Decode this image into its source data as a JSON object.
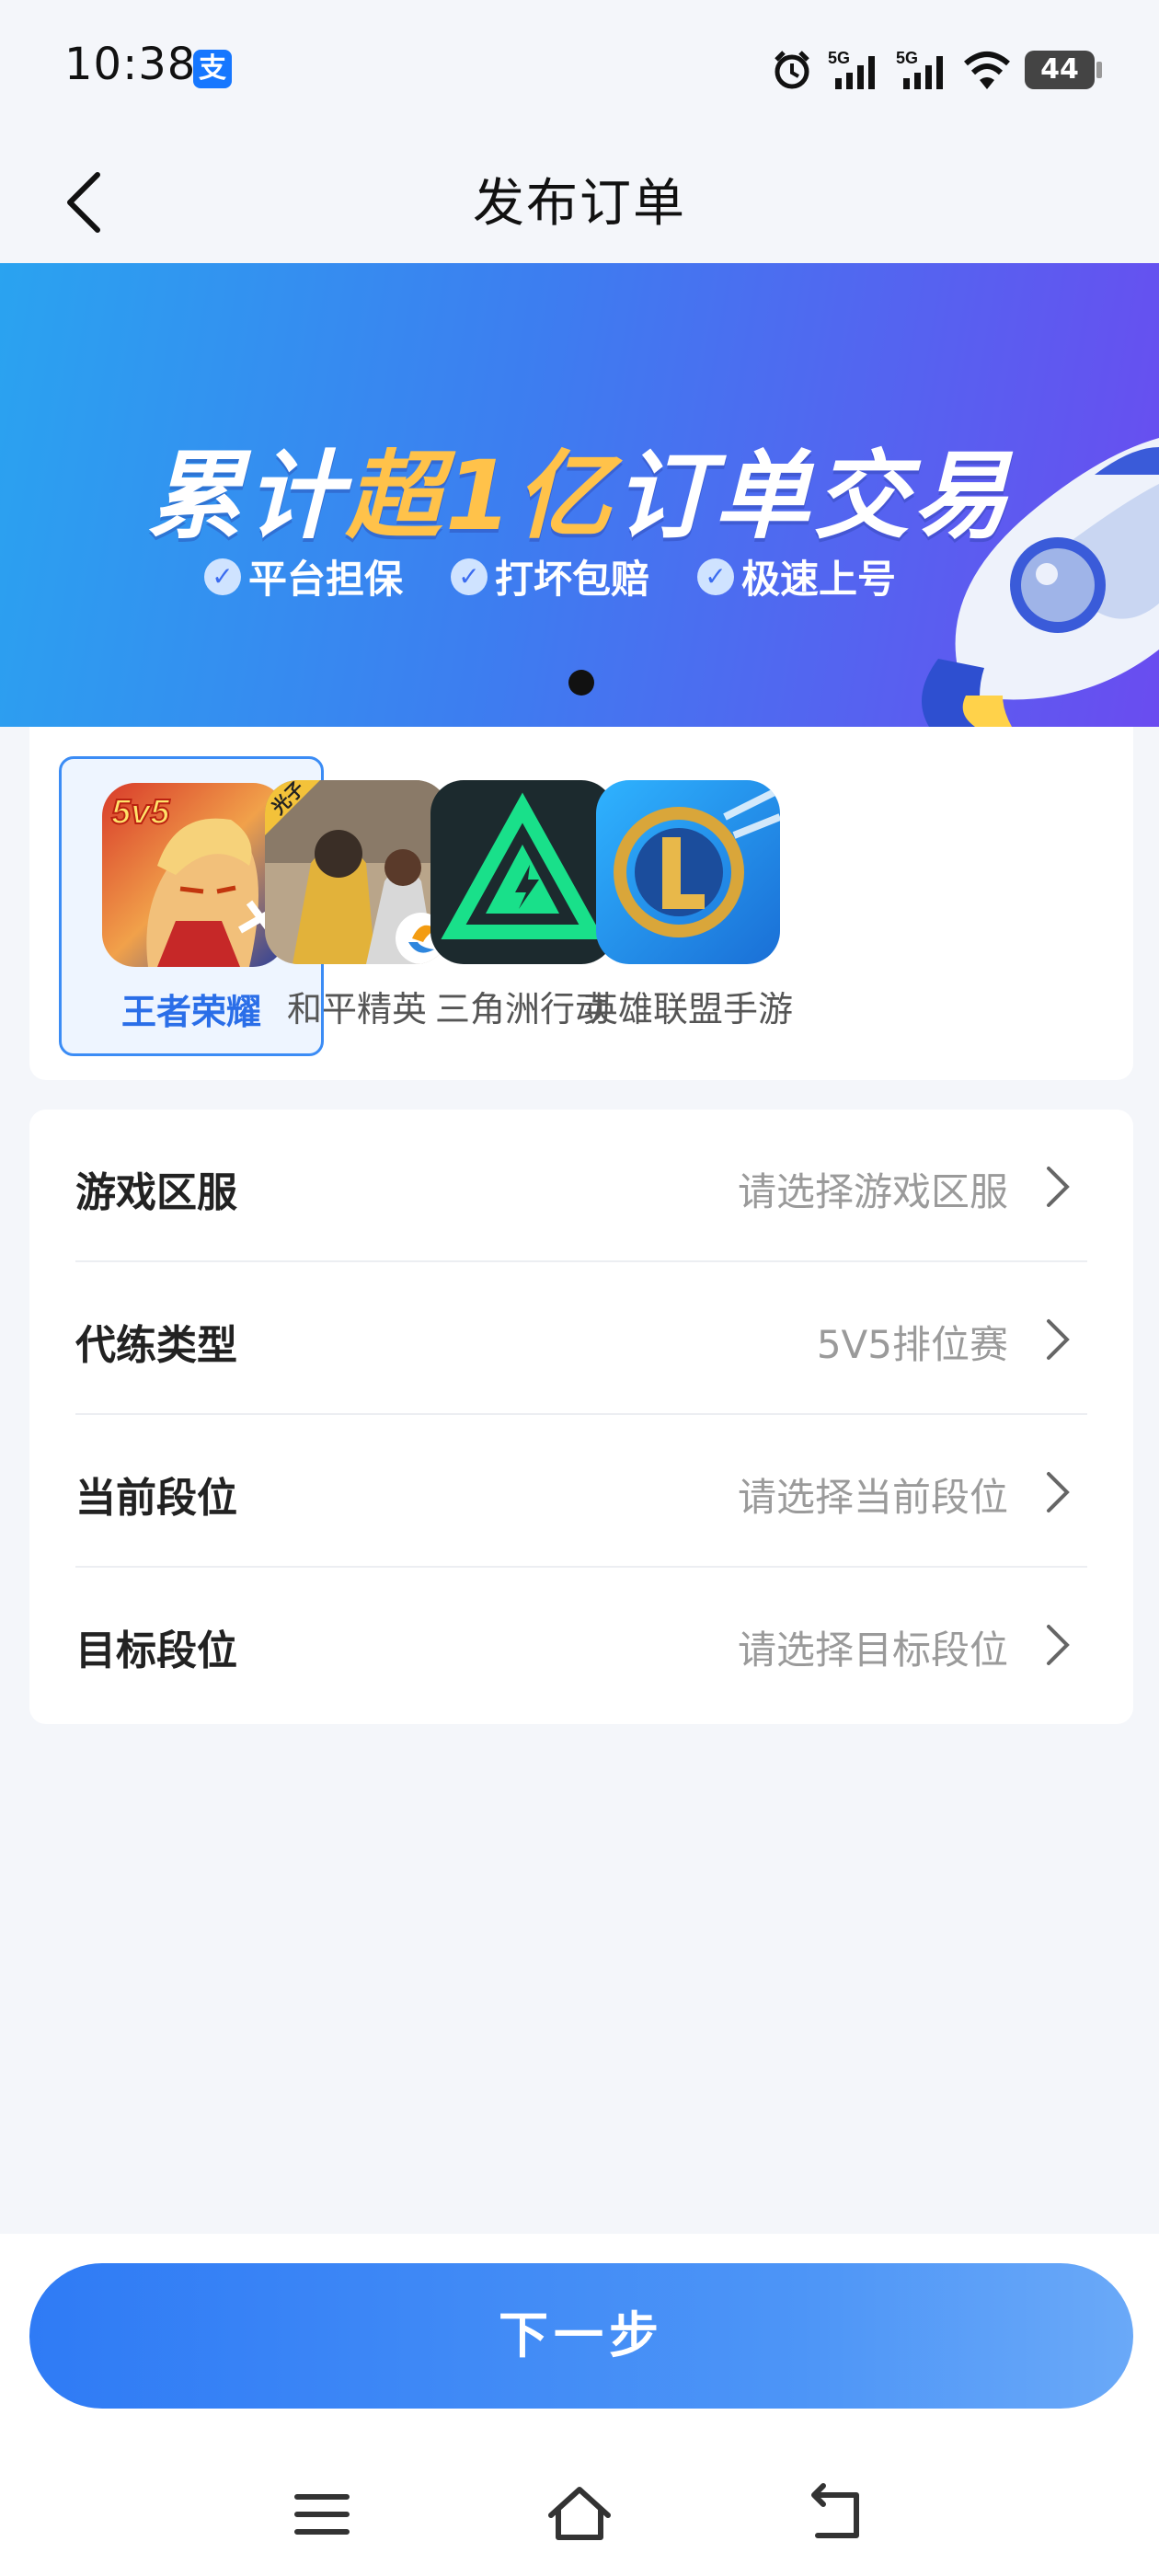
{
  "status_bar": {
    "time": "10:38",
    "app_badge": "支",
    "signal_1_label": "5G",
    "signal_2_label": "5G",
    "battery": "44"
  },
  "header": {
    "title": "发布订单"
  },
  "banner": {
    "headline_part1": "累计",
    "headline_highlight": "超1亿",
    "headline_part2": "订单交易",
    "features": [
      "平台担保",
      "打坏包赔",
      "极速上号"
    ],
    "colors": {
      "start": "#2aa3f0",
      "end": "#6a4cf0",
      "highlight": "#ffc24a"
    }
  },
  "games": [
    {
      "name": "王者荣耀",
      "selected": true,
      "icon": "honor-of-kings-icon",
      "badge": "5v5"
    },
    {
      "name": "和平精英",
      "selected": false,
      "icon": "peacekeeper-elite-icon",
      "badge": "光子"
    },
    {
      "name": "三角洲行动",
      "selected": false,
      "icon": "delta-force-icon"
    },
    {
      "name": "英雄联盟手游",
      "selected": false,
      "icon": "league-of-legends-mobile-icon"
    }
  ],
  "form": {
    "rows": [
      {
        "label": "游戏区服",
        "value": "请选择游戏区服",
        "is_placeholder": true
      },
      {
        "label": "代练类型",
        "value": "5V5排位赛",
        "is_placeholder": false
      },
      {
        "label": "当前段位",
        "value": "请选择当前段位",
        "is_placeholder": true
      },
      {
        "label": "目标段位",
        "value": "请选择目标段位",
        "is_placeholder": true
      }
    ]
  },
  "actions": {
    "next_label": "下一步"
  },
  "theme": {
    "accent": "#2f7bf5",
    "selected_text": "#2a6ee8",
    "placeholder": "#9a9a9a"
  }
}
